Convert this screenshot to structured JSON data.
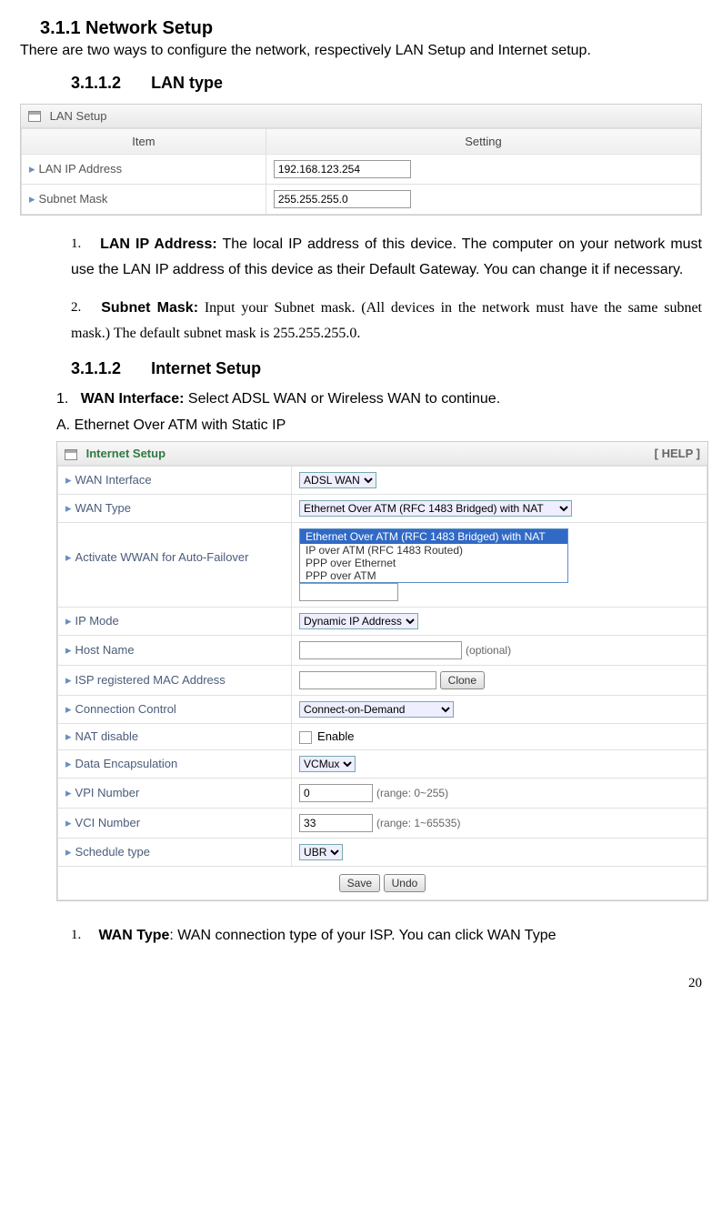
{
  "section": {
    "number": "3.1.1",
    "title": "Network Setup",
    "intro": "There are two ways to configure the network, respectively LAN Setup and Internet setup."
  },
  "lan": {
    "heading_num": "3.1.1.2",
    "heading_title": "LAN type",
    "panel_title": "LAN Setup",
    "col_item": "Item",
    "col_setting": "Setting",
    "rows": {
      "ip_label": "LAN IP Address",
      "ip_value": "192.168.123.254",
      "mask_label": "Subnet Mask",
      "mask_value": "255.255.255.0"
    },
    "bullets": {
      "b1_num": "1.",
      "b1_strong": "LAN IP Address:",
      "b1_text": " The local IP address of this device. The computer on your network must use the LAN IP address of this device as their Default Gateway. You can change it if necessary.",
      "b2_num": "2.",
      "b2_strong": "Subnet Mask:",
      "b2_text": " Input your Subnet mask. (All devices in the network must have the same subnet mask.) The default subnet mask is 255.255.255.0."
    }
  },
  "internet": {
    "heading_num": "3.1.1.2",
    "heading_title": "Internet Setup",
    "bullet1_num": "1.",
    "bullet1_strong": "WAN Interface:",
    "bullet1_text": " Select ADSL WAN or Wireless WAN to continue.",
    "label_A": "A. Ethernet Over ATM with Static IP",
    "panel_title": "Internet Setup",
    "help": "[ HELP ]",
    "rows": {
      "wan_if_label": "WAN Interface",
      "wan_if_value": "ADSL WAN",
      "wan_type_label": "WAN Type",
      "wan_type_value": "Ethernet Over ATM (RFC 1483 Bridged) with NAT",
      "wan_type_opts": {
        "o1": "Ethernet Over ATM (RFC 1483 Bridged) with NAT",
        "o2": "IP over ATM (RFC 1483 Routed)",
        "o3": "PPP over Ethernet",
        "o4": "PPP over ATM"
      },
      "wwan_label": "Activate WWAN for Auto-Failover",
      "ipmode_label": "IP Mode",
      "ipmode_value": "Dynamic IP Address",
      "host_label": "Host Name",
      "host_hint": "(optional)",
      "mac_label": "ISP registered MAC Address",
      "clone_btn": "Clone",
      "conn_label": "Connection Control",
      "conn_value": "Connect-on-Demand",
      "nat_label": "NAT disable",
      "nat_enable": "Enable",
      "encap_label": "Data Encapsulation",
      "encap_value": "VCMux",
      "vpi_label": "VPI Number",
      "vpi_value": "0",
      "vpi_hint": "(range: 0~255)",
      "vci_label": "VCI Number",
      "vci_value": "33",
      "vci_hint": "(range: 1~65535)",
      "sched_label": "Schedule type",
      "sched_value": "UBR",
      "save_btn": "Save",
      "undo_btn": "Undo"
    },
    "trailing": {
      "num": "1.",
      "strong": "WAN Type",
      "text": ": WAN connection type of your ISP. You can click WAN Type"
    }
  },
  "page_number": "20"
}
